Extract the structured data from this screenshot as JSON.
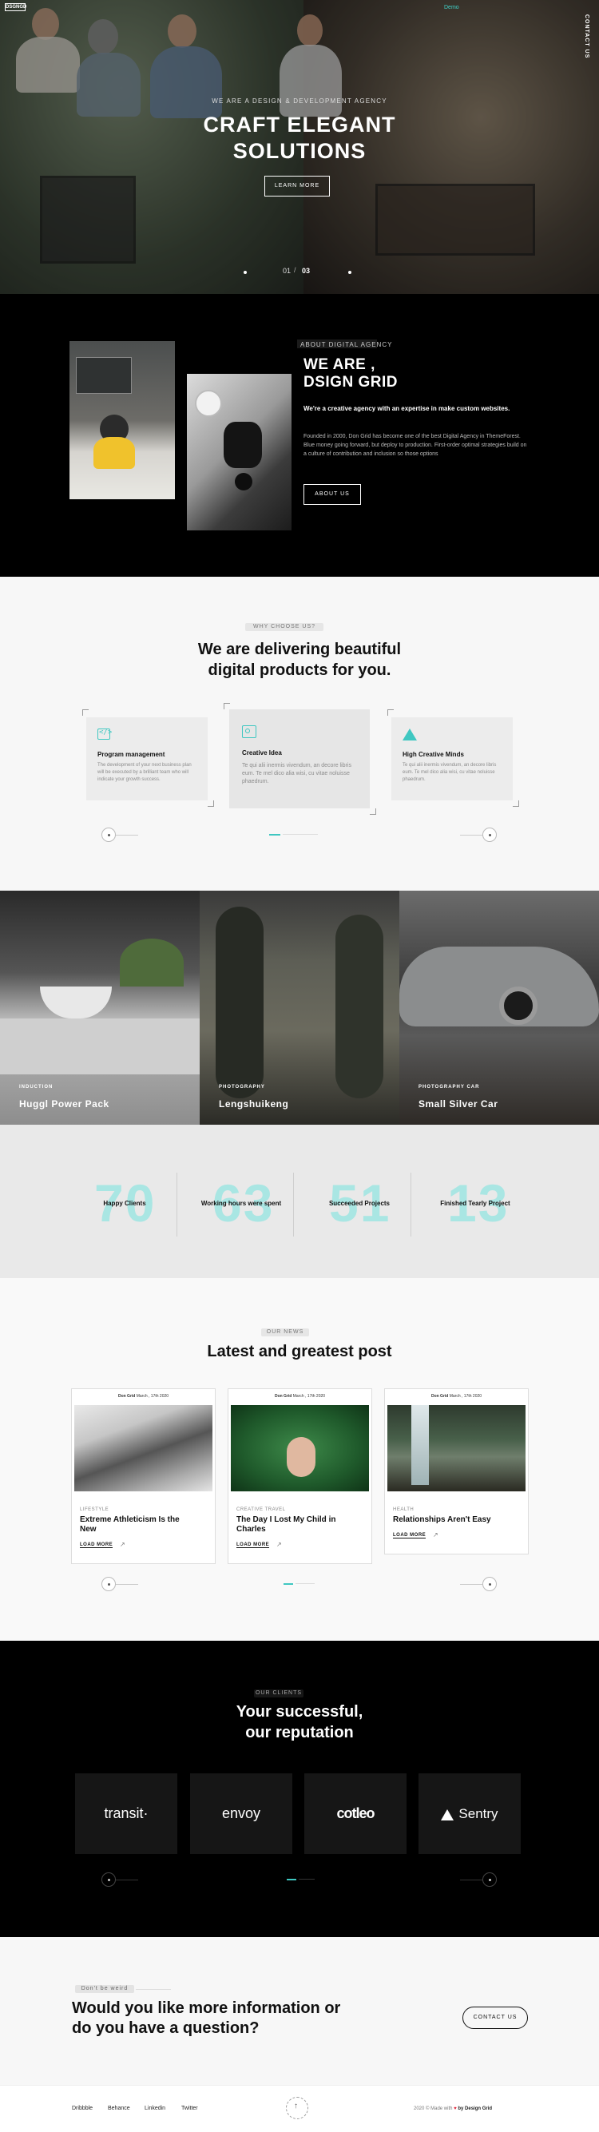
{
  "header": {
    "logo": "DSGNGD",
    "nav_link": "Demo",
    "contact_vertical": "CONTACT US"
  },
  "hero": {
    "eyebrow": "WE ARE A DESIGN & DEVELOPMENT AGENCY",
    "title_line1": "CRAFT ELEGANT",
    "title_line2": "SOLUTIONS",
    "cta": "LEARN MORE",
    "slide_current": "01",
    "slide_total": "03"
  },
  "about": {
    "tag": "ABOUT DIGITAL AGENCY",
    "title_line1": "WE ARE ,",
    "title_line2": "DSIGN GRID",
    "lead": "We're a creative agency with an expertise in make custom websites.",
    "body": "Founded in 2000, Don Grid has become one of the best Digital Agency in ThemeForest. Blue money going forward, but deploy to production. First-order optimal strategies build on a culture of contribution and inclusion so those options",
    "cta": "ABOUT US"
  },
  "why": {
    "tag": "WHY CHOOSE US?",
    "title_line1": "We are delivering beautiful",
    "title_line2": "digital products for you.",
    "cards": [
      {
        "icon": "code-icon",
        "title": "Program management",
        "text": "The development of your next business plan will be executed by a brilliant team who will indicate your growth success."
      },
      {
        "icon": "image-icon",
        "title": "Creative Idea",
        "text": "Te qui alii inermis vivendum, an decore libris eum. Te mel dico alia wisi, cu vitae noluisse phaedrum."
      },
      {
        "icon": "triangle-icon",
        "title": "High Creative Minds",
        "text": "Te qui alii inermis vivendum, an decore libris eum. Te mel dico alia wisi, cu vitae noluisse phaedrum."
      }
    ]
  },
  "portfolio": [
    {
      "category": "INDUCTION",
      "title": "Huggl Power Pack"
    },
    {
      "category": "PHOTOGRAPHY",
      "title": "Lengshuikeng"
    },
    {
      "category": "PHOTOGRAPHY        CAR",
      "title": "Small Silver Car"
    }
  ],
  "stats": [
    {
      "number": "70",
      "label": "Happy Clients"
    },
    {
      "number": "63",
      "label": "Working hours were spent"
    },
    {
      "number": "51",
      "label": "Succeeded Projects"
    },
    {
      "number": "13",
      "label": "Finished Tearly Project"
    }
  ],
  "news": {
    "tag": "OUR NEWS",
    "title": "Latest and greatest post",
    "posts": [
      {
        "author": "Don Grid",
        "date": "March , 17th 2020",
        "category": "LIFESTYLE",
        "title_line1": "Extreme Athleticism Is the",
        "title_line2": "New",
        "more": "LOAD MORE"
      },
      {
        "author": "Don Grid",
        "date": "March , 17th 2020",
        "category": "CREATIVE   TRAVEL",
        "title_line1": "The Day I Lost My Child in",
        "title_line2": "Charles",
        "more": "LOAD MORE"
      },
      {
        "author": "Don Grid",
        "date": "March , 17th 2020",
        "category": "HEALTH",
        "title_line1": "Relationships Aren't Easy",
        "title_line2": "",
        "more": "LOAD MORE"
      }
    ]
  },
  "clients": {
    "tag": "OUR CLIENTS",
    "title_line1": "Your successful,",
    "title_line2": "our reputation",
    "logos": [
      "transit·",
      "envoy",
      "cotleo",
      "Sentry"
    ]
  },
  "cta": {
    "tag": "Don't be weird",
    "title_line1": "Would you like more information or",
    "title_line2": "do you have a question?",
    "button": "CONTACT US"
  },
  "footer": {
    "links": [
      "Dribbble",
      "Behance",
      "Linkedin",
      "Twitter"
    ],
    "copyright_prefix": "2020 © Made with",
    "copyright_suffix": "by Design Grid"
  },
  "colors": {
    "accent": "#3fc7c1",
    "stat_number": "#a9e6e3",
    "heart": "#e0253a"
  }
}
